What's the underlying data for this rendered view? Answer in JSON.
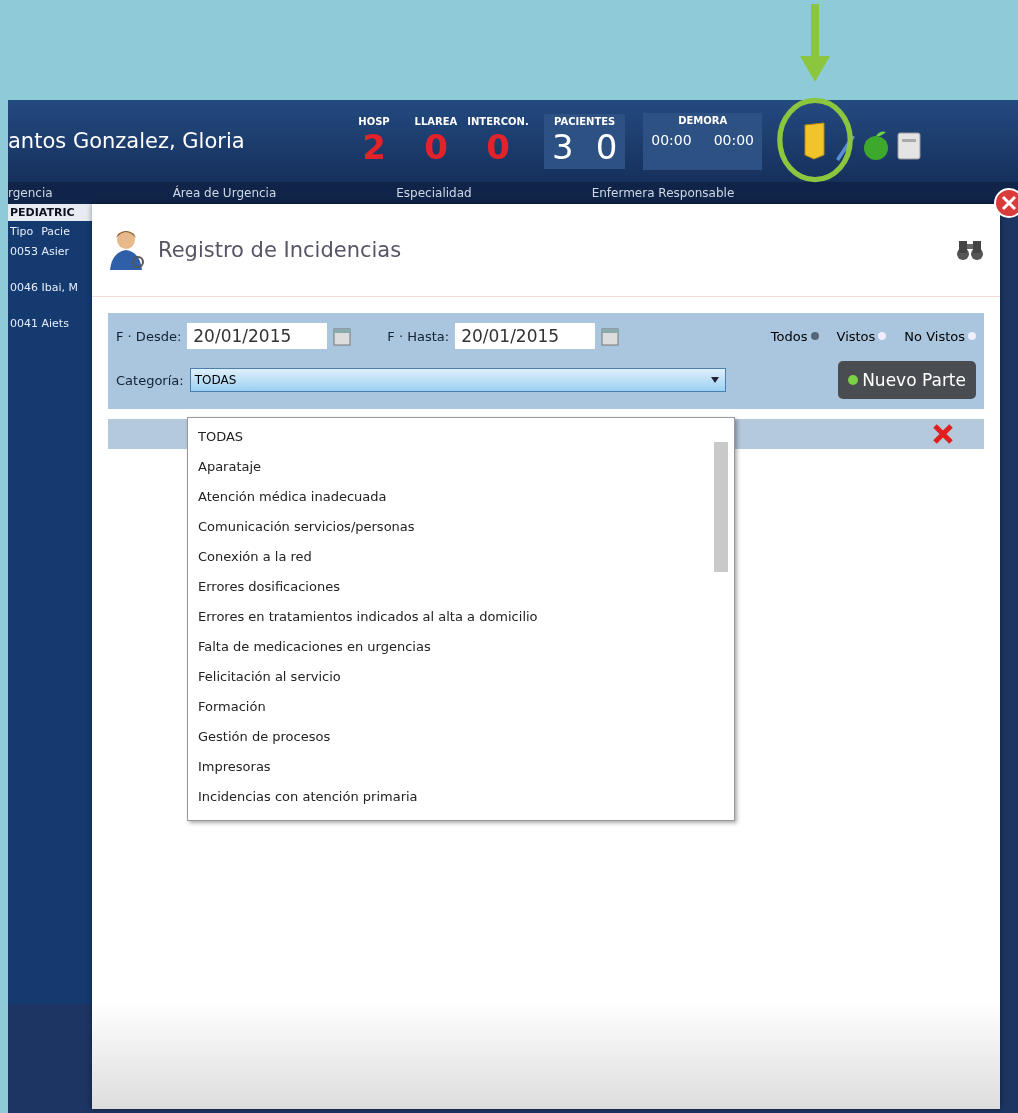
{
  "header": {
    "user_name": "antos Gonzalez, Gloria",
    "counters": [
      {
        "label": "HOSP",
        "value": "2"
      },
      {
        "label": "LLAREA",
        "value": "0"
      },
      {
        "label": "INTERCON.",
        "value": "0"
      }
    ],
    "pacientes": {
      "title": "PACIENTES",
      "values": [
        "3",
        "0"
      ]
    },
    "demora": {
      "title": "DEMORA",
      "values": [
        "00:00",
        "00:00"
      ]
    }
  },
  "nav": [
    "rgencia",
    "Área de Urgencia",
    "Especialidad",
    "Enfermera Responsable"
  ],
  "side_panel": {
    "title": "PEDIATRIC",
    "columns": [
      "Tipo",
      "Pacie"
    ],
    "rows": [
      "0053 Asier",
      "0046 Ibai, M",
      "0041 Aiets"
    ]
  },
  "dialog": {
    "title": "Registro de Incidencias",
    "filters": {
      "desde_label": "F · Desde:",
      "desde_value": "20/01/2015",
      "hasta_label": "F · Hasta:",
      "hasta_value": "20/01/2015",
      "radios": [
        {
          "label": "Todos",
          "selected": true
        },
        {
          "label": "Vistos",
          "selected": false
        },
        {
          "label": "No Vistos",
          "selected": false
        }
      ],
      "category_label": "Categoría:",
      "category_value": "TODAS"
    },
    "new_button": "Nuevo Parte",
    "dropdown": [
      "TODAS",
      "Aparataje",
      "Atención médica inadecuada",
      "Comunicación servicios/personas",
      "Conexión a la red",
      "Errores dosificaciones",
      "Errores en tratamientos indicados al alta a domicilio",
      "Falta de medicaciones en urgencias",
      "Felicitación al servicio",
      "Formación",
      "Gestión de procesos",
      "Impresoras",
      "Incidencias con atención primaria"
    ]
  }
}
